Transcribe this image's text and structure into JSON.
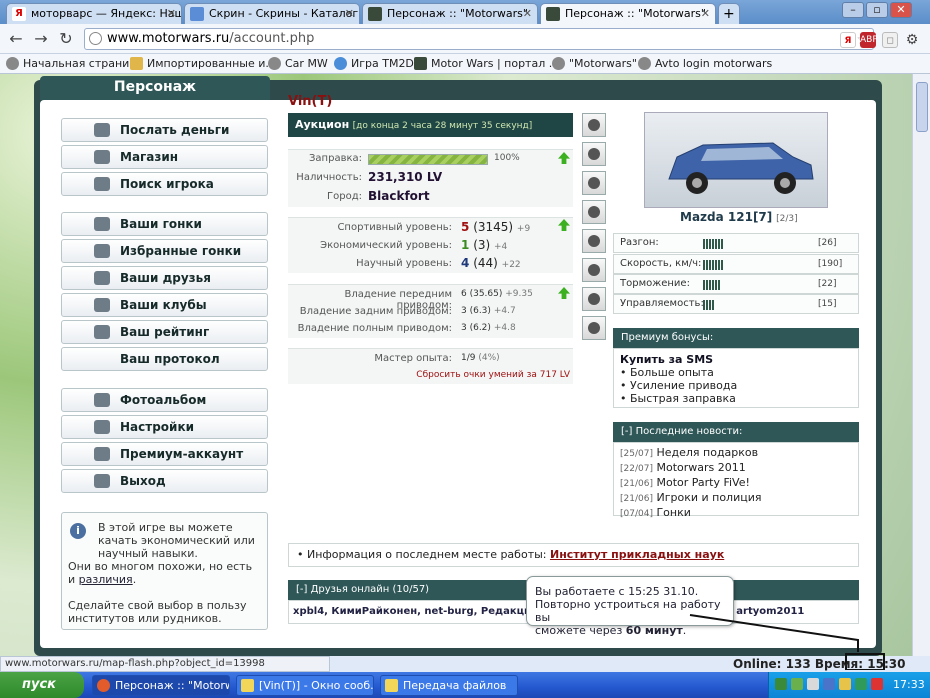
{
  "browser": {
    "tabs": [
      {
        "label": "моторварс — Яндекс: Нашло",
        "icon": "Я"
      },
      {
        "label": "Скрин - Скрины - Каталог ф",
        "icon": ""
      },
      {
        "label": "Персонаж :: \"Motorwars\"",
        "icon": ""
      },
      {
        "label": "Персонаж :: \"Motorwars\"",
        "icon": ""
      }
    ],
    "url_domain": "www.motorwars.ru",
    "url_path": "/account.php",
    "bookmarks": [
      "Начальная страница",
      "Импортированные и...",
      "Car MW",
      "Игра TM2D",
      "Motor Wars | портал ...",
      "\"Motorwars\"",
      "Avto login motorwars"
    ]
  },
  "page": {
    "section_title": "Персонаж",
    "menu": {
      "group1": [
        "Послать деньги",
        "Магазин",
        "Поиск игрока"
      ],
      "group2": [
        "Ваши гонки",
        "Избранные гонки",
        "Ваши друзья",
        "Ваши клубы",
        "Ваш рейтинг",
        "Ваш протокол"
      ],
      "group3": [
        "Фотоальбом",
        "Настройки",
        "Премиум-аккаунт",
        "Выход"
      ]
    },
    "info": {
      "text1": "В этой игре вы можете качать экономический или научный навыки.",
      "text2": "Они во многом похожи, но есть и ",
      "link": "различия",
      "text3": "Сделайте свой выбор в пользу институтов или рудников."
    },
    "player_name": "Vin(T)",
    "auction": {
      "label": "Аукцион",
      "detail": "[до конца 2 часа 28 минут 35 секунд]"
    },
    "stats": {
      "fuel_label": "Заправка:",
      "fuel_value": "100%",
      "fuel_fraction": 1.0,
      "cash_label": "Наличность:",
      "cash_value": "231,310 LV",
      "city_label": "Город:",
      "city_value": "Blackfort"
    },
    "levels": [
      {
        "label": "Спортивный уровень:",
        "value": "5",
        "paren": "(3145)",
        "delta": "+9",
        "color": "red"
      },
      {
        "label": "Экономический уровень:",
        "value": "1",
        "paren": "(3)",
        "delta": "+4",
        "color": "green"
      },
      {
        "label": "Научный уровень:",
        "value": "4",
        "paren": "(44)",
        "delta": "+22",
        "color": "blue"
      }
    ],
    "drive": [
      {
        "label": "Владение передним приводом:",
        "value": "6 (35.65)",
        "delta": "+9.35"
      },
      {
        "label": "Владение задним приводом:",
        "value": "3 (6.3)",
        "delta": "+4.7"
      },
      {
        "label": "Владение полным приводом:",
        "value": "3 (6.2)",
        "delta": "+4.8"
      }
    ],
    "master": {
      "label": "Мастер опыта:",
      "value": "1/9",
      "pct": "(4%)",
      "reset": "Сбросить очки умений за 717 LV"
    },
    "car": {
      "name": "Mazda 121[7]",
      "count": "[2/3]"
    },
    "car_stats": [
      {
        "label": "Разгон:",
        "value": "[26]",
        "bars": 7
      },
      {
        "label": "Скорость, км/ч:",
        "value": "[190]",
        "bars": 7
      },
      {
        "label": "Торможение:",
        "value": "[22]",
        "bars": 6
      },
      {
        "label": "Управляемость:",
        "value": "[15]",
        "bars": 4
      }
    ],
    "premium": {
      "title": "Премиум бонусы:",
      "buy": "Купить за SMS",
      "items": [
        "Больше опыта",
        "Усиление привода",
        "Быстрая заправка"
      ]
    },
    "news": {
      "title": "[-]  Последние новости:",
      "items": [
        {
          "date": "[25/07]",
          "text": "Неделя подарков"
        },
        {
          "date": "[22/07]",
          "text": "Motorwars 2011"
        },
        {
          "date": "[21/06]",
          "text": "Motor Party FiVe!"
        },
        {
          "date": "[21/06]",
          "text": "Игроки и полиция"
        },
        {
          "date": "[07/04]",
          "text": "Гонки"
        }
      ]
    },
    "work": {
      "prefix": "•  Информация о последнем месте работы: ",
      "link": "Институт прикладных наук"
    },
    "friends": {
      "title": "[-]  Друзья онлайн (10/57)",
      "list": "xpbl4, КимиРайконен, net-burg, Редакция, krolik",
      "tail": ", artyom2011"
    },
    "tooltip": {
      "line1": "Вы работаете с 15:25 31.10.",
      "line2": "Повторно устроиться на работу вы",
      "line3": "сможете через ",
      "bold": "60 минут",
      "end": "."
    },
    "online": "Online: 133",
    "time_label": "Время:",
    "time": "15:30"
  },
  "status_url": "www.motorwars.ru/map-flash.php?object_id=13998",
  "taskbar": {
    "start": "пуск",
    "buttons": [
      "Персонаж :: \"Motorw...",
      "[Vin(T)] - Окно сооб...",
      "Передача файлов"
    ],
    "clock": "17:33"
  },
  "colors": {
    "header": "#2f5757",
    "accent_red": "#a01010",
    "taskbar": "#2458cf"
  }
}
